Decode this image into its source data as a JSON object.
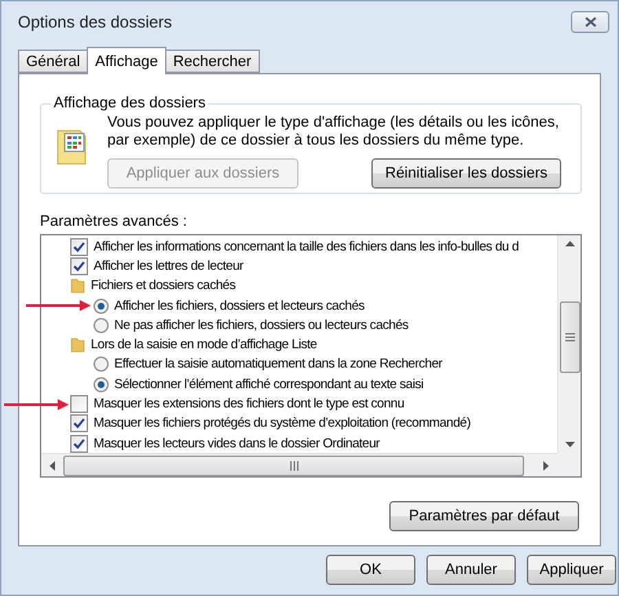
{
  "window": {
    "title": "Options des dossiers"
  },
  "tabs": [
    {
      "label": "Général",
      "selected": false
    },
    {
      "label": "Affichage",
      "selected": true
    },
    {
      "label": "Rechercher",
      "selected": false
    }
  ],
  "folder_views": {
    "title": "Affichage des dossiers",
    "description": "Vous pouvez appliquer le type d'affichage (les détails ou les icônes, par exemple) de ce dossier à tous les dossiers du même type.",
    "buttons": [
      {
        "label": "Appliquer aux dossiers",
        "disabled": true
      },
      {
        "label": "Réinitialiser les dossiers",
        "disabled": false
      }
    ]
  },
  "advanced": {
    "label": "Paramètres avancés :",
    "items": [
      {
        "kind": "checkbox",
        "label": "Afficher les informations concernant la taille des fichiers dans les info-bulles du d",
        "checked": true,
        "marked": false
      },
      {
        "kind": "checkbox",
        "label": "Afficher les lettres de lecteur",
        "checked": true,
        "marked": false
      },
      {
        "kind": "folder",
        "label": "Fichiers et dossiers cachés",
        "children": [
          {
            "kind": "radio",
            "label": "Afficher les fichiers, dossiers et lecteurs cachés",
            "selected": true,
            "marked": true
          },
          {
            "kind": "radio",
            "label": "Ne pas afficher les fichiers, dossiers ou lecteurs cachés",
            "selected": false,
            "marked": false
          }
        ]
      },
      {
        "kind": "folder",
        "label": "Lors de la saisie en mode d’affichage Liste",
        "children": [
          {
            "kind": "radio",
            "label": "Effectuer la saisie automatiquement dans la zone Rechercher",
            "selected": false,
            "marked": false
          },
          {
            "kind": "radio",
            "label": "Sélectionner l’élément affiché correspondant au texte saisi",
            "selected": true,
            "marked": false
          }
        ]
      },
      {
        "kind": "checkbox",
        "label": "Masquer les extensions des fichiers dont le type est connu",
        "checked": false,
        "marked": true
      },
      {
        "kind": "checkbox",
        "label": "Masquer les fichiers protégés du système d’exploitation (recommandé)",
        "checked": true,
        "marked": false
      },
      {
        "kind": "checkbox",
        "label": "Masquer les lecteurs vides dans le dossier Ordinateur",
        "checked": true,
        "marked": false
      }
    ],
    "default_button": "Paramètres par défaut"
  },
  "buttons": [
    "OK",
    "Annuler",
    "Appliquer"
  ]
}
